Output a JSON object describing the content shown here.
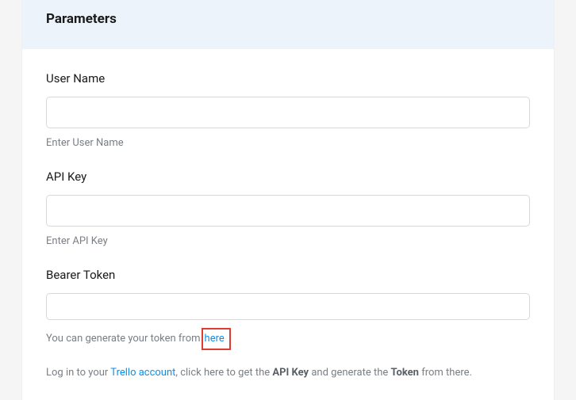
{
  "header": {
    "title": "Parameters"
  },
  "fields": {
    "username": {
      "label": "User Name",
      "hint": "Enter User Name",
      "value": ""
    },
    "apikey": {
      "label": "API Key",
      "hint": "Enter API Key",
      "value": ""
    },
    "bearer": {
      "label": "Bearer Token",
      "hint_prefix": "You can generate your token from",
      "hint_link": "here",
      "value": ""
    }
  },
  "info": {
    "prefix": "Log in to your ",
    "link": "Trello account",
    "mid1": ", click here to get the ",
    "bold1": "API Key",
    "mid2": " and generate the ",
    "bold2": "Token",
    "suffix": " from there."
  }
}
